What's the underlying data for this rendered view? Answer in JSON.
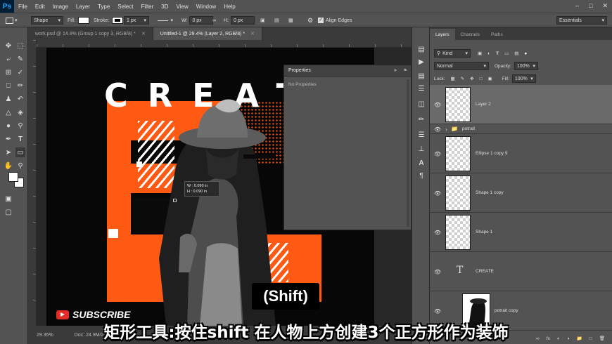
{
  "app": {
    "logo": "Ps"
  },
  "menubar": {
    "items": [
      "File",
      "Edit",
      "Image",
      "Layer",
      "Type",
      "Select",
      "Filter",
      "3D",
      "View",
      "Window",
      "Help"
    ]
  },
  "options_bar": {
    "mode": "Shape",
    "fill_label": "Fill:",
    "stroke_label": "Stroke:",
    "stroke_width": "1 px",
    "w_label": "W:",
    "w_value": "0 px",
    "h_label": "H:",
    "h_value": "0 px",
    "align_edges": "Align Edges",
    "workspace": "Essentials"
  },
  "doc_tabs": [
    {
      "label": "work.psd @ 14.9% (Group 1 copy 3, RGB/8) *",
      "active": false
    },
    {
      "label": "Untitled-1 @ 29.4% (Layer 2, RGB/8) *",
      "active": true
    }
  ],
  "artwork": {
    "headline": "CREAT",
    "measure_w": "W :  0.090 in",
    "measure_h": "H :  0.090 in",
    "accent_color": "#ff5a14"
  },
  "properties": {
    "title": "Properties",
    "empty_text": "No Properties"
  },
  "status": {
    "zoom": "29.35%",
    "doc_size": "Doc: 24.9M/28.8M"
  },
  "layers_panel": {
    "tabs": [
      "Layers",
      "Channels",
      "Paths"
    ],
    "filter": "Kind",
    "blend_mode": "Normal",
    "opacity_label": "Opacity:",
    "opacity_value": "100%",
    "lock_label": "Lock:",
    "fill_label": "Fill:",
    "fill_value": "100%",
    "layers": [
      {
        "name": "Layer 2",
        "kind": "pixel",
        "selected": true
      },
      {
        "name": "potrait",
        "kind": "group"
      },
      {
        "name": "Ellipse 1 copy 9",
        "kind": "shape"
      },
      {
        "name": "Shape 1 copy",
        "kind": "shape"
      },
      {
        "name": "Shape 1",
        "kind": "shape"
      },
      {
        "name": "CREATE",
        "kind": "text"
      },
      {
        "name": "potrait copy",
        "kind": "image"
      }
    ]
  },
  "overlay": {
    "subscribe": "SUBSCRIBE",
    "key_hint": "(Shift)",
    "subtitle": "矩形工具:按住shift 在人物上方创建3个正方形作为装饰"
  }
}
